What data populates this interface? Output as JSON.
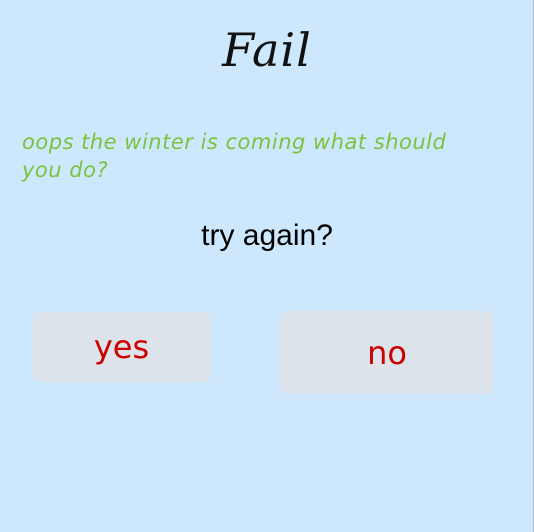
{
  "dialog": {
    "title": "Fail",
    "message": "oops the winter is coming what should you do?",
    "prompt": "try again?",
    "yes_label": "yes",
    "no_label": "no"
  },
  "colors": {
    "background": "#cde8fc",
    "message_text": "#7cc23f",
    "button_background": "#dde3ea",
    "button_text": "#cc0000"
  }
}
